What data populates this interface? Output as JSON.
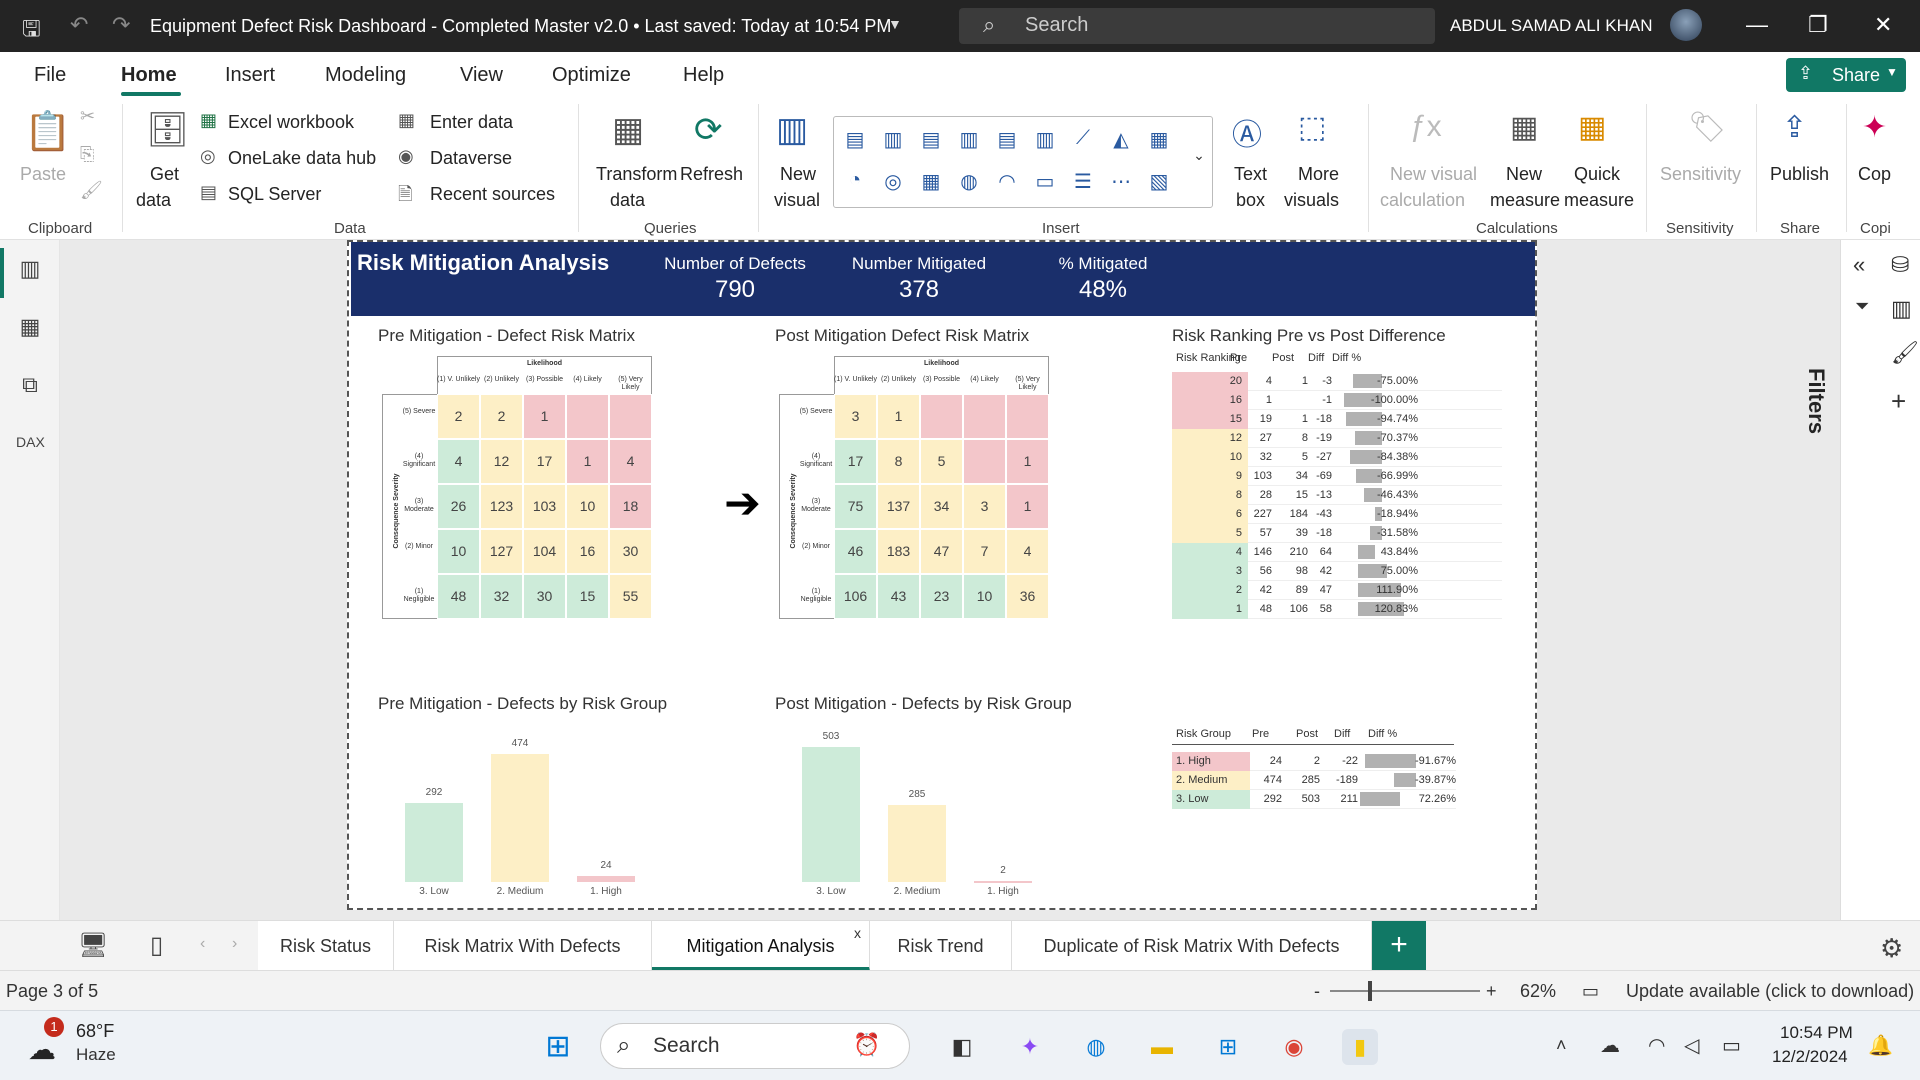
{
  "titlebar": {
    "doc_title": "Equipment Defect Risk Dashboard - Completed Master v2.0  •  Last saved: Today at 10:54 PM",
    "search_placeholder": "Search",
    "user_name": "ABDUL SAMAD ALI KHAN"
  },
  "ribbon_tabs": [
    "File",
    "Home",
    "Insert",
    "Modeling",
    "View",
    "Optimize",
    "Help"
  ],
  "share_label": "Share",
  "ribbon": {
    "paste": "Paste",
    "get_data": "Get",
    "get_data2": "data",
    "excel": "Excel workbook",
    "onelake": "OneLake data hub",
    "sql": "SQL Server",
    "enter_data": "Enter data",
    "dataverse": "Dataverse",
    "recent": "Recent sources",
    "transform": "Transform",
    "transform2": "data",
    "refresh": "Refresh",
    "new_visual": "New",
    "new_visual2": "visual",
    "text_box": "Text",
    "text_box2": "box",
    "more_visuals": "More",
    "more_visuals2": "visuals",
    "new_visual_calc": "New visual",
    "new_visual_calc2": "calculation",
    "new_measure": "New",
    "new_measure2": "measure",
    "quick_measure": "Quick",
    "quick_measure2": "measure",
    "sensitivity": "Sensitivity",
    "publish": "Publish",
    "copilot": "Cop",
    "groups": {
      "clipboard": "Clipboard",
      "data": "Data",
      "queries": "Queries",
      "insert": "Insert",
      "calculations": "Calculations",
      "sensitivity": "Sensitivity",
      "share": "Share",
      "copilot": "Copi"
    }
  },
  "report": {
    "title": "Risk Mitigation Analysis",
    "kpis": [
      {
        "label": "Number of Defects",
        "value": "790"
      },
      {
        "label": "Number Mitigated",
        "value": "378"
      },
      {
        "label": "% Mitigated",
        "value": "48%"
      }
    ],
    "pre_matrix_title": "Pre Mitigation - Defect Risk Matrix",
    "post_matrix_title": "Post Mitigation Defect Risk Matrix",
    "ranking_title": "Risk Ranking Pre vs Post Difference",
    "pre_bar_title": "Pre Mitigation - Defects by Risk Group",
    "post_bar_title": "Post Mitigation - Defects by Risk Group",
    "likelihood_label": "Likelihood",
    "severity_label": "Consequence Severity",
    "likelihood_cols": [
      "(1) V. Unlikely",
      "(2) Unlikely",
      "(3) Possible",
      "(4) Likely",
      "(5) Very Likely"
    ],
    "severity_rows": [
      "(5) Severe",
      "(4) Significant",
      "(3) Moderate",
      "(2) Minor",
      "(1) Negligible"
    ],
    "pre_matrix": [
      [
        "2",
        "2",
        "1",
        "",
        ""
      ],
      [
        "4",
        "12",
        "17",
        "1",
        "4"
      ],
      [
        "26",
        "123",
        "103",
        "10",
        "18"
      ],
      [
        "10",
        "127",
        "104",
        "16",
        "30"
      ],
      [
        "48",
        "32",
        "30",
        "15",
        "55"
      ]
    ],
    "post_matrix": [
      [
        "3",
        "1",
        "",
        "",
        ""
      ],
      [
        "17",
        "8",
        "5",
        "",
        "1"
      ],
      [
        "75",
        "137",
        "34",
        "3",
        "1"
      ],
      [
        "46",
        "183",
        "47",
        "7",
        "4"
      ],
      [
        "106",
        "43",
        "23",
        "10",
        "36"
      ]
    ],
    "matrix_colors": [
      [
        "y",
        "y",
        "r",
        "r",
        "r"
      ],
      [
        "g",
        "y",
        "y",
        "r",
        "r"
      ],
      [
        "g",
        "y",
        "y",
        "y",
        "r"
      ],
      [
        "g",
        "y",
        "y",
        "y",
        "y"
      ],
      [
        "g",
        "g",
        "g",
        "g",
        "y"
      ]
    ],
    "ranking_headers": [
      "Risk Ranking",
      "Pre",
      "Post",
      "Diff",
      "Diff %"
    ],
    "ranking_rows": [
      {
        "rank": "20",
        "pre": "4",
        "post": "1",
        "diff": "-3",
        "pct": "-75.00%",
        "v": -0.75,
        "c": "r"
      },
      {
        "rank": "16",
        "pre": "1",
        "post": "",
        "diff": "-1",
        "pct": "-100.00%",
        "v": -1.0,
        "c": "r"
      },
      {
        "rank": "15",
        "pre": "19",
        "post": "1",
        "diff": "-18",
        "pct": "-94.74%",
        "v": -0.9474,
        "c": "r"
      },
      {
        "rank": "12",
        "pre": "27",
        "post": "8",
        "diff": "-19",
        "pct": "-70.37%",
        "v": -0.7037,
        "c": "y"
      },
      {
        "rank": "10",
        "pre": "32",
        "post": "5",
        "diff": "-27",
        "pct": "-84.38%",
        "v": -0.8438,
        "c": "y"
      },
      {
        "rank": "9",
        "pre": "103",
        "post": "34",
        "diff": "-69",
        "pct": "-66.99%",
        "v": -0.6699,
        "c": "y"
      },
      {
        "rank": "8",
        "pre": "28",
        "post": "15",
        "diff": "-13",
        "pct": "-46.43%",
        "v": -0.4643,
        "c": "y"
      },
      {
        "rank": "6",
        "pre": "227",
        "post": "184",
        "diff": "-43",
        "pct": "-18.94%",
        "v": -0.1894,
        "c": "y"
      },
      {
        "rank": "5",
        "pre": "57",
        "post": "39",
        "diff": "-18",
        "pct": "-31.58%",
        "v": -0.3158,
        "c": "y"
      },
      {
        "rank": "4",
        "pre": "146",
        "post": "210",
        "diff": "64",
        "pct": "43.84%",
        "v": 0.4384,
        "c": "g"
      },
      {
        "rank": "3",
        "pre": "56",
        "post": "98",
        "diff": "42",
        "pct": "75.00%",
        "v": 0.75,
        "c": "g"
      },
      {
        "rank": "2",
        "pre": "42",
        "post": "89",
        "diff": "47",
        "pct": "111.90%",
        "v": 1.119,
        "c": "g"
      },
      {
        "rank": "1",
        "pre": "48",
        "post": "106",
        "diff": "58",
        "pct": "120.83%",
        "v": 1.2083,
        "c": "g"
      }
    ],
    "group_headers": [
      "Risk Group",
      "Pre",
      "Post",
      "Diff",
      "Diff %"
    ],
    "group_rows": [
      {
        "group": "1. High",
        "pre": "24",
        "post": "2",
        "diff": "-22",
        "pct": "-91.67%",
        "v": -0.9167,
        "c": "r"
      },
      {
        "group": "2. Medium",
        "pre": "474",
        "post": "285",
        "diff": "-189",
        "pct": "-39.87%",
        "v": -0.3987,
        "c": "y"
      },
      {
        "group": "3. Low",
        "pre": "292",
        "post": "503",
        "diff": "211",
        "pct": "72.26%",
        "v": 0.7226,
        "c": "g"
      }
    ]
  },
  "chart_data": [
    {
      "type": "bar",
      "title": "Pre Mitigation - Defects by Risk Group",
      "categories": [
        "3. Low",
        "2. Medium",
        "1. High"
      ],
      "values": [
        292,
        474,
        24
      ],
      "colors": [
        "#cdebd9",
        "#fdefc6",
        "#f3c6ca"
      ]
    },
    {
      "type": "bar",
      "title": "Post Mitigation - Defects by Risk Group",
      "categories": [
        "3. Low",
        "2. Medium",
        "1. High"
      ],
      "values": [
        503,
        285,
        2
      ],
      "colors": [
        "#cdebd9",
        "#fdefc6",
        "#f3c6ca"
      ]
    }
  ],
  "page_tabs": [
    "Risk Status",
    "Risk Matrix With Defects",
    "Mitigation Analysis",
    "Risk Trend",
    "Duplicate of Risk Matrix With Defects"
  ],
  "status": {
    "page": "Page 3 of 5",
    "zoom": "62%",
    "update": "Update available (click to download)"
  },
  "filters_label": "Filters",
  "taskbar": {
    "weather_temp": "68°F",
    "weather_desc": "Haze",
    "search": "Search",
    "time": "10:54 PM",
    "date": "12/2/2024",
    "badge": "1"
  },
  "colors": {
    "green": "#cdebd9",
    "yellow": "#fdefc6",
    "red": "#f3c6ca",
    "header": "#1a2f6b",
    "accent": "#117865"
  }
}
